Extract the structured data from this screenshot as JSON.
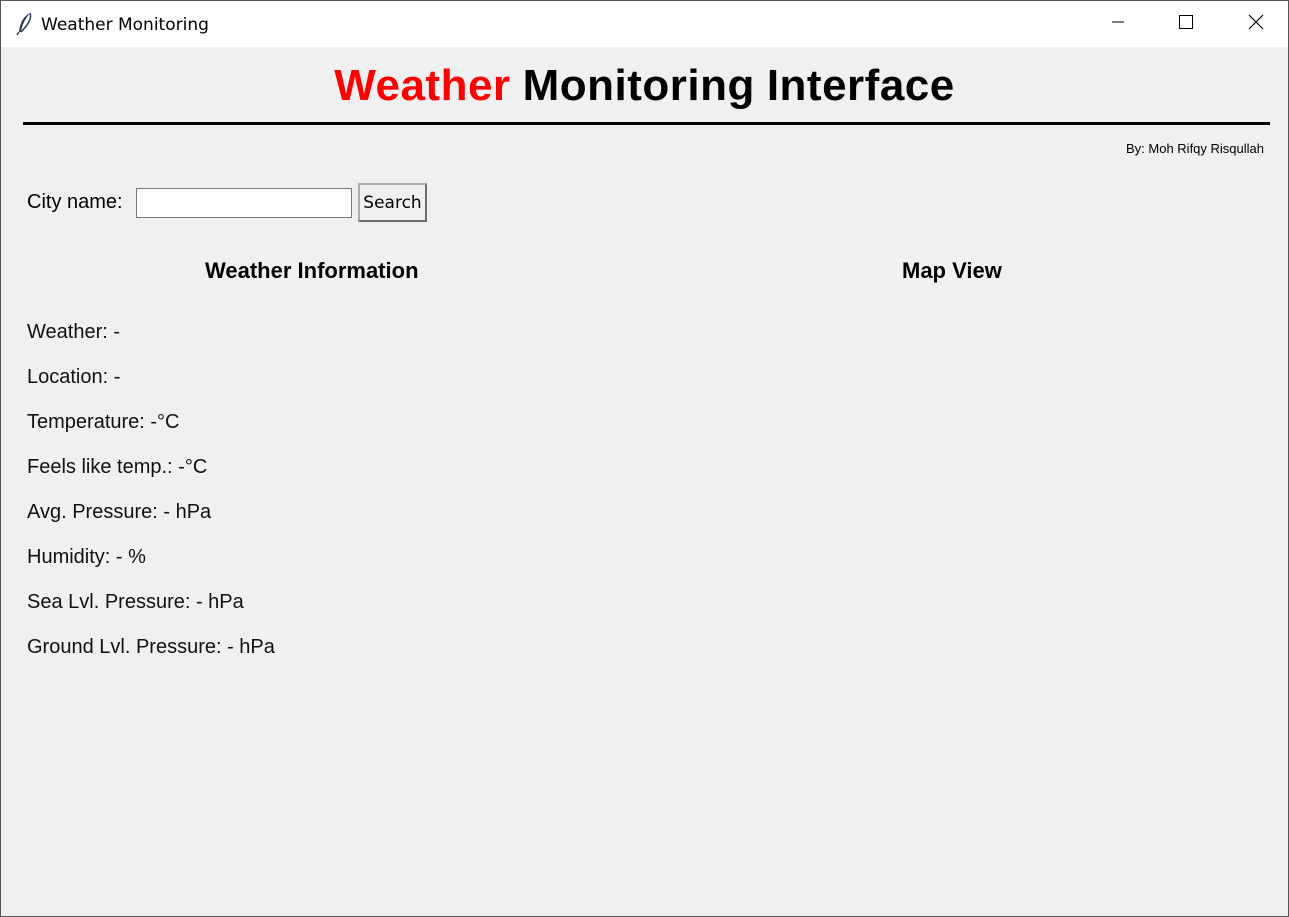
{
  "window": {
    "title": "Weather Monitoring"
  },
  "header": {
    "word1": "Weather",
    "word2": "Monitoring",
    "word3": "Interface",
    "accent_color": "#ff0000"
  },
  "byline": "By: Moh Rifqy Risqullah",
  "search": {
    "label": "City name:",
    "value": "",
    "placeholder": "",
    "button_label": "Search"
  },
  "sections": {
    "info_title": "Weather Information",
    "map_title": "Map View"
  },
  "info": [
    "Weather: -",
    "Location: -",
    "Temperature: -°C",
    "Feels like temp.: -°C",
    "Avg. Pressure: - hPa",
    "Humidity: - %",
    "Sea Lvl. Pressure: - hPa",
    "Ground Lvl. Pressure: - hPa"
  ]
}
